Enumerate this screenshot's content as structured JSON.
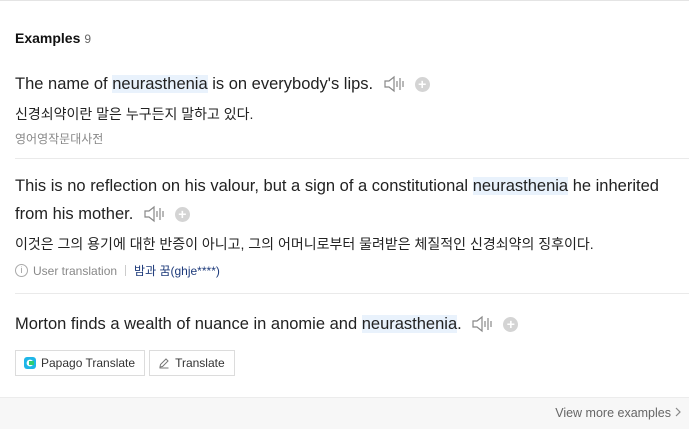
{
  "header": {
    "title": "Examples",
    "count": "9"
  },
  "examples": [
    {
      "pre": "The name of ",
      "keyword": "neurasthenia",
      "post": " is on everybody's lips.",
      "translation": "신경쇠약이란 말은 누구든지 말하고 있다.",
      "source": "영어영작문대사전"
    },
    {
      "pre": "This is no reflection on his valour, but a sign of a constitutional ",
      "keyword": "neurasthenia",
      "post": " he inherited from his mother.",
      "translation": "이것은 그의 용기에 대한 반증이 아니고, 그의 어머니로부터 물려받은 체질적인 신경쇠약의 징후이다.",
      "meta_label": "User translation",
      "meta_user": "밤과 꿈(ghje****)"
    },
    {
      "pre": "Morton finds a wealth of nuance in anomie and ",
      "keyword": "neurasthenia",
      "post": ".",
      "buttons": {
        "papago": "Papago Translate",
        "translate": "Translate"
      }
    }
  ],
  "footer": {
    "view_more": "View more examples"
  },
  "icons": {
    "speaker": "speaker-icon",
    "add": "plus-icon",
    "info": "info-icon",
    "papago": "papago-logo-icon",
    "translate": "pencil-icon",
    "chevron": "chevron-right-icon"
  },
  "colors": {
    "highlight": "#e9f2fc",
    "user_link": "#1d3a7a"
  }
}
